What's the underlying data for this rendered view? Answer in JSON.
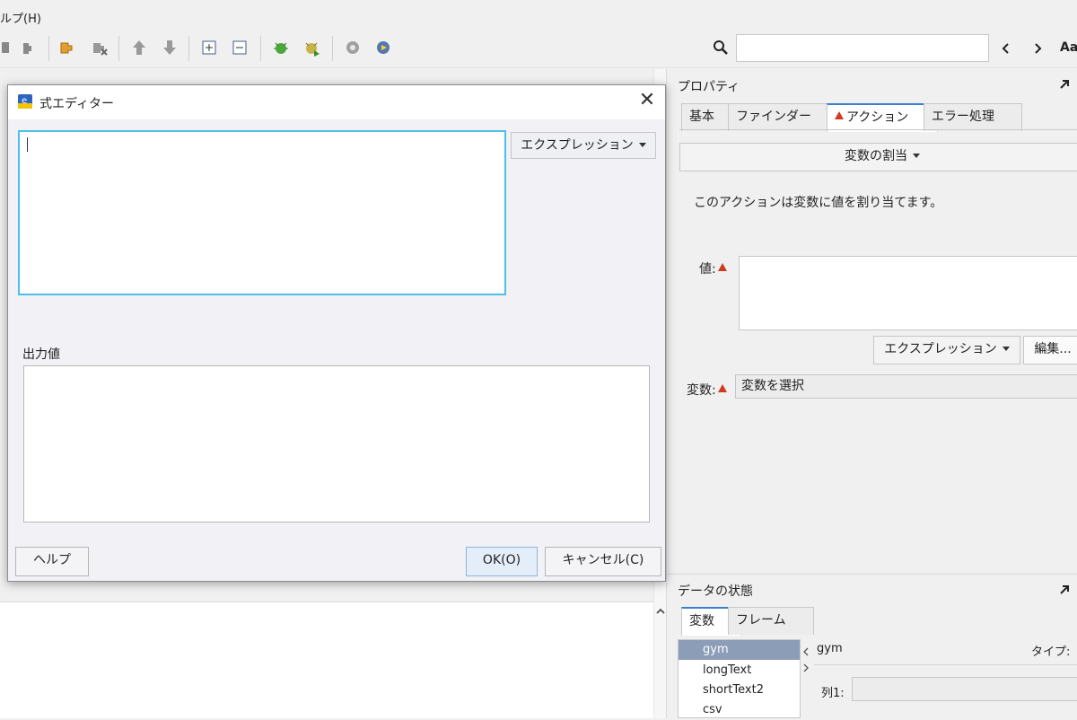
{
  "menu": {
    "help_label": "ルプ(H)"
  },
  "toolbar": {
    "text_case_label": "Aa"
  },
  "dialog": {
    "title": "式エディター",
    "close_glyph": "✕",
    "expression_dropdown": "エクスプレッション",
    "output_label": "出力値",
    "help_button": "ヘルプ",
    "ok_button": "OK(O)",
    "cancel_button": "キャンセル(C)"
  },
  "properties": {
    "title": "プロパティ",
    "tabs": [
      "基本",
      "ファインダー",
      "アクション",
      "エラー処理"
    ],
    "active_tab_index": 2,
    "action_dropdown": "変数の割当",
    "description": "このアクションは変数に値を割り当てます。",
    "value_label": "値:",
    "expression_button": "エクスプレッション",
    "edit_button": "編集...",
    "variable_label": "変数:",
    "variable_select": "変数を選択"
  },
  "data_state": {
    "title": "データの状態",
    "tabs": [
      "変数",
      "フレーム"
    ],
    "variables": [
      "gym",
      "longText",
      "shortText2",
      "csv"
    ],
    "selected_variable": "gym",
    "detail_name": "gym",
    "type_label": "タイプ:",
    "column_label": "列1:"
  },
  "colors": {
    "accent": "#3c7fd0",
    "focus_border": "#4cc0e8",
    "warning": "#d23a1e",
    "selection": "#8c9db8"
  }
}
